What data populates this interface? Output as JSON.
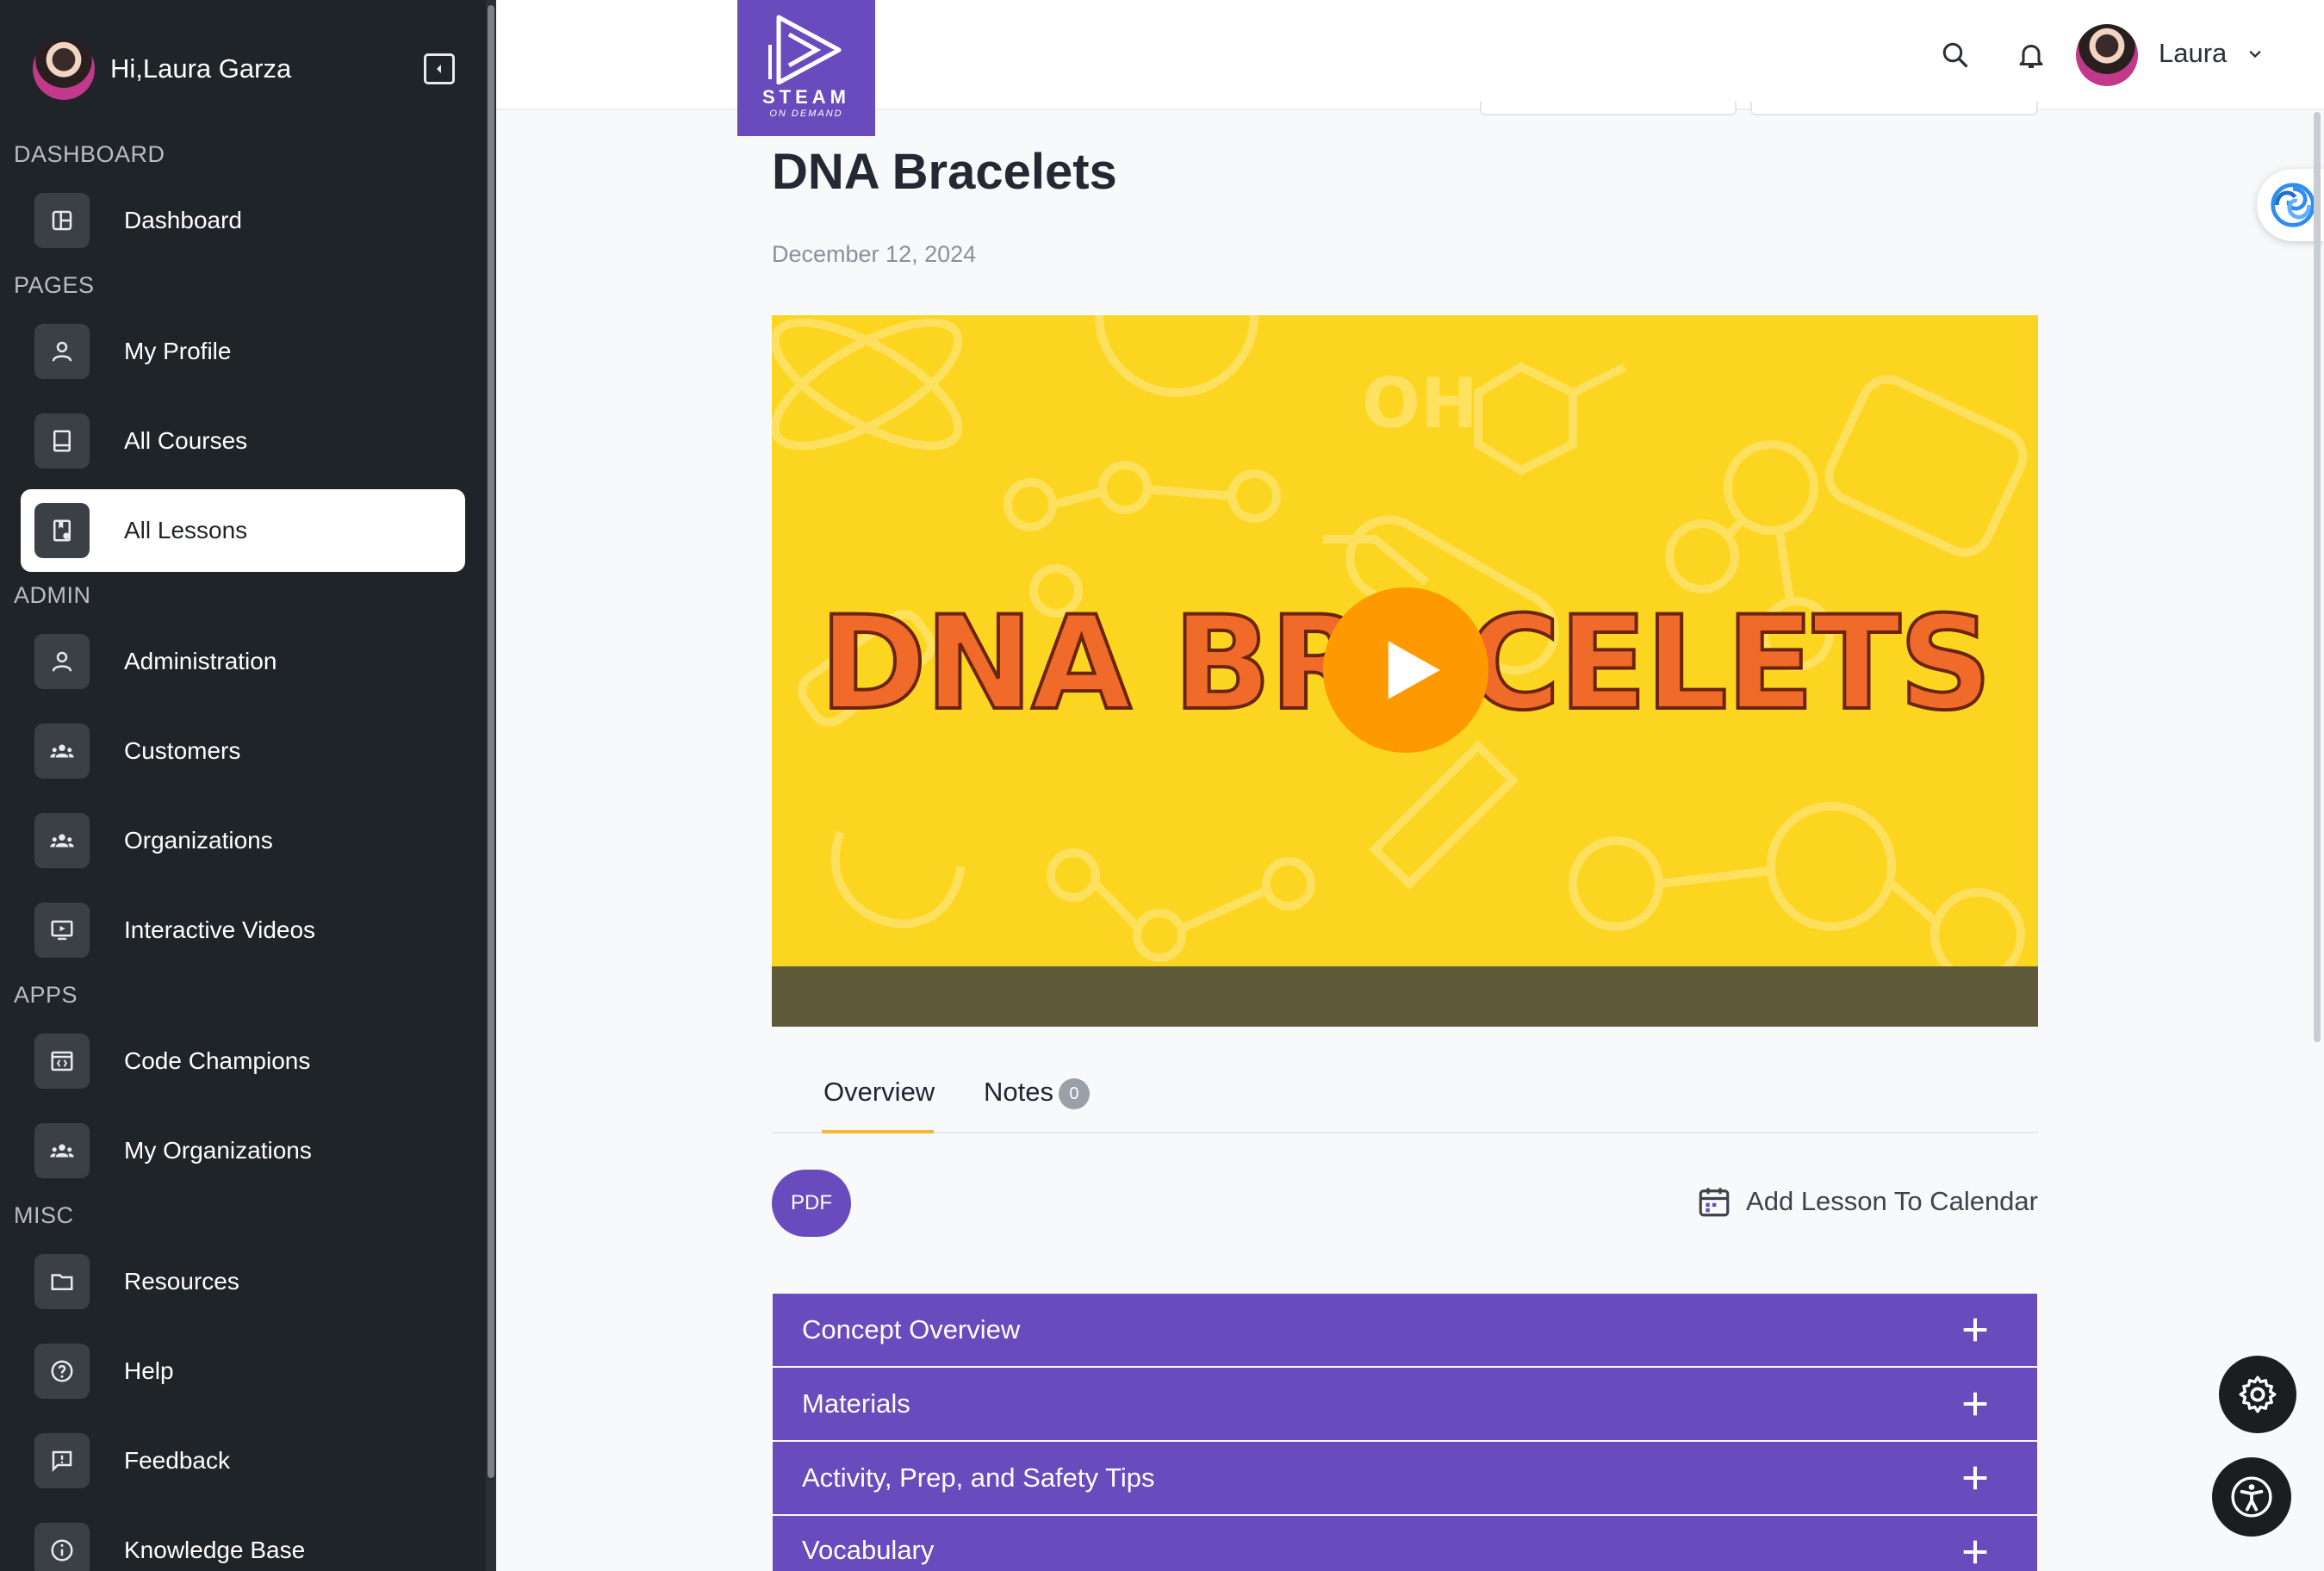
{
  "user": {
    "greeting": "Hi,Laura Garza",
    "short_name": "Laura"
  },
  "sidebar": {
    "sections": [
      {
        "label": "DASHBOARD"
      },
      {
        "label": "PAGES"
      },
      {
        "label": "ADMIN"
      },
      {
        "label": "APPS"
      },
      {
        "label": "MISC"
      }
    ],
    "items": [
      {
        "label": "Dashboard",
        "icon": "dashboard-icon"
      },
      {
        "label": "My Profile",
        "icon": "user-icon"
      },
      {
        "label": "All Courses",
        "icon": "book-icon"
      },
      {
        "label": "All Lessons",
        "icon": "lesson-icon",
        "active": true
      },
      {
        "label": "Administration",
        "icon": "user-icon"
      },
      {
        "label": "Customers",
        "icon": "group-icon"
      },
      {
        "label": "Organizations",
        "icon": "group-icon"
      },
      {
        "label": "Interactive Videos",
        "icon": "video-icon"
      },
      {
        "label": "Code Champions",
        "icon": "code-icon"
      },
      {
        "label": "My Organizations",
        "icon": "group-icon"
      },
      {
        "label": "Resources",
        "icon": "folder-icon"
      },
      {
        "label": "Help",
        "icon": "help-icon"
      },
      {
        "label": "Feedback",
        "icon": "feedback-icon"
      },
      {
        "label": "Knowledge Base",
        "icon": "info-icon"
      }
    ]
  },
  "logo": {
    "line1": "STEAM",
    "line2": "ON DEMAND"
  },
  "lesson": {
    "title": "DNA Bracelets",
    "date": "December 12, 2024",
    "video_title": "DNA BRACELETS"
  },
  "tabs": [
    {
      "label": "Overview",
      "active": true
    },
    {
      "label": "Notes",
      "count": "0"
    }
  ],
  "actions": {
    "pdf": "PDF",
    "calendar": "Add Lesson To Calendar"
  },
  "accordion": [
    {
      "label": "Concept Overview"
    },
    {
      "label": "Materials"
    },
    {
      "label": "Activity, Prep, and Safety Tips"
    },
    {
      "label": "Vocabulary"
    }
  ],
  "colors": {
    "brand": "#6a4bbd",
    "sidebar": "#1f2428",
    "accent": "#f5b638",
    "video_bg": "#fcd521",
    "play": "#ff9900"
  }
}
